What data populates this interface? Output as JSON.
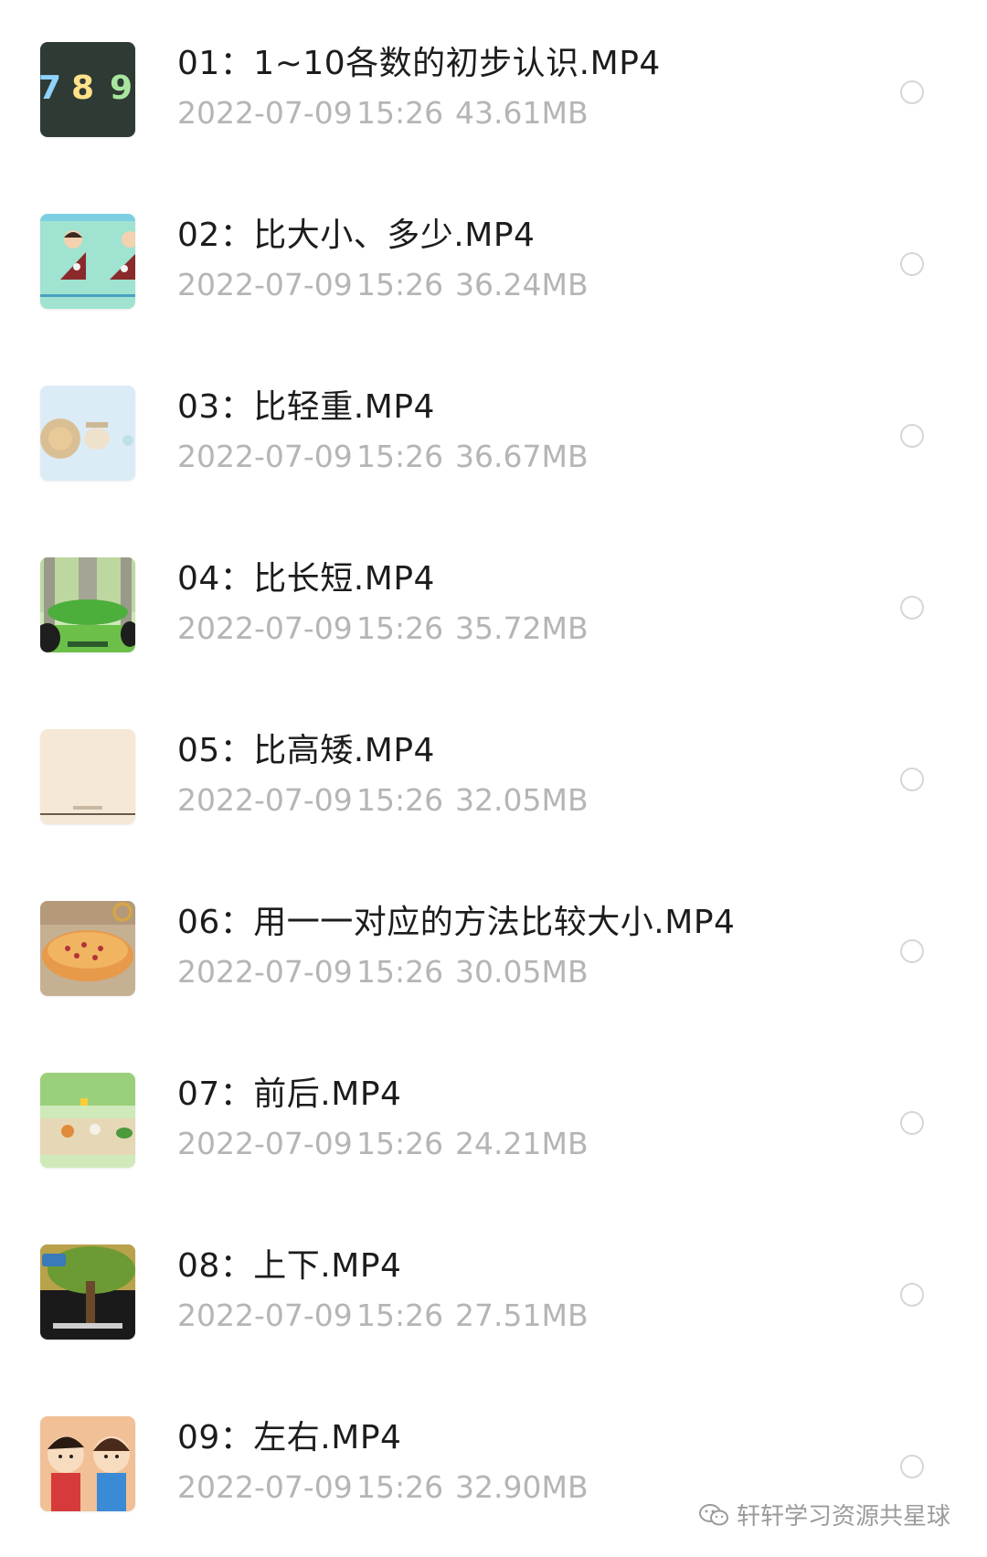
{
  "files": [
    {
      "index": "01",
      "title": "01：1~10各数的初步认识.MP4",
      "date": "2022-07-09",
      "time": "15:26",
      "size": "43.61MB",
      "thumb": "numbers-789",
      "thumb_text": "7 8 9"
    },
    {
      "index": "02",
      "title": "02：比大小、多少.MP4",
      "date": "2022-07-09",
      "time": "15:26",
      "size": "36.24MB",
      "thumb": "cartoon-kids-compare"
    },
    {
      "index": "03",
      "title": "03：比轻重.MP4",
      "date": "2022-07-09",
      "time": "15:26",
      "size": "36.67MB",
      "thumb": "lion-scale"
    },
    {
      "index": "04",
      "title": "04：比长短.MP4",
      "date": "2022-07-09",
      "time": "15:26",
      "size": "35.72MB",
      "thumb": "forest-trees"
    },
    {
      "index": "05",
      "title": "05：比高矮.MP4",
      "date": "2022-07-09",
      "time": "15:26",
      "size": "32.05MB",
      "thumb": "plain-beige"
    },
    {
      "index": "06",
      "title": "06：用一一对应的方法比较大小.MP4",
      "date": "2022-07-09",
      "time": "15:26",
      "size": "30.05MB",
      "thumb": "pizza-plate"
    },
    {
      "index": "07",
      "title": "07：前后.MP4",
      "date": "2022-07-09",
      "time": "15:26",
      "size": "24.21MB",
      "thumb": "animals-race"
    },
    {
      "index": "08",
      "title": "08：上下.MP4",
      "date": "2022-07-09",
      "time": "15:26",
      "size": "27.51MB",
      "thumb": "tree-bird"
    },
    {
      "index": "09",
      "title": "09：左右.MP4",
      "date": "2022-07-09",
      "time": "15:26",
      "size": "32.90MB",
      "thumb": "two-kids"
    }
  ],
  "watermark": {
    "text": "轩轩学习资源共星球",
    "icon": "wechat-icon"
  },
  "colors": {
    "title": "#1c1c1c",
    "meta": "#b5b5b5",
    "radio_border": "#d6d6d6"
  }
}
